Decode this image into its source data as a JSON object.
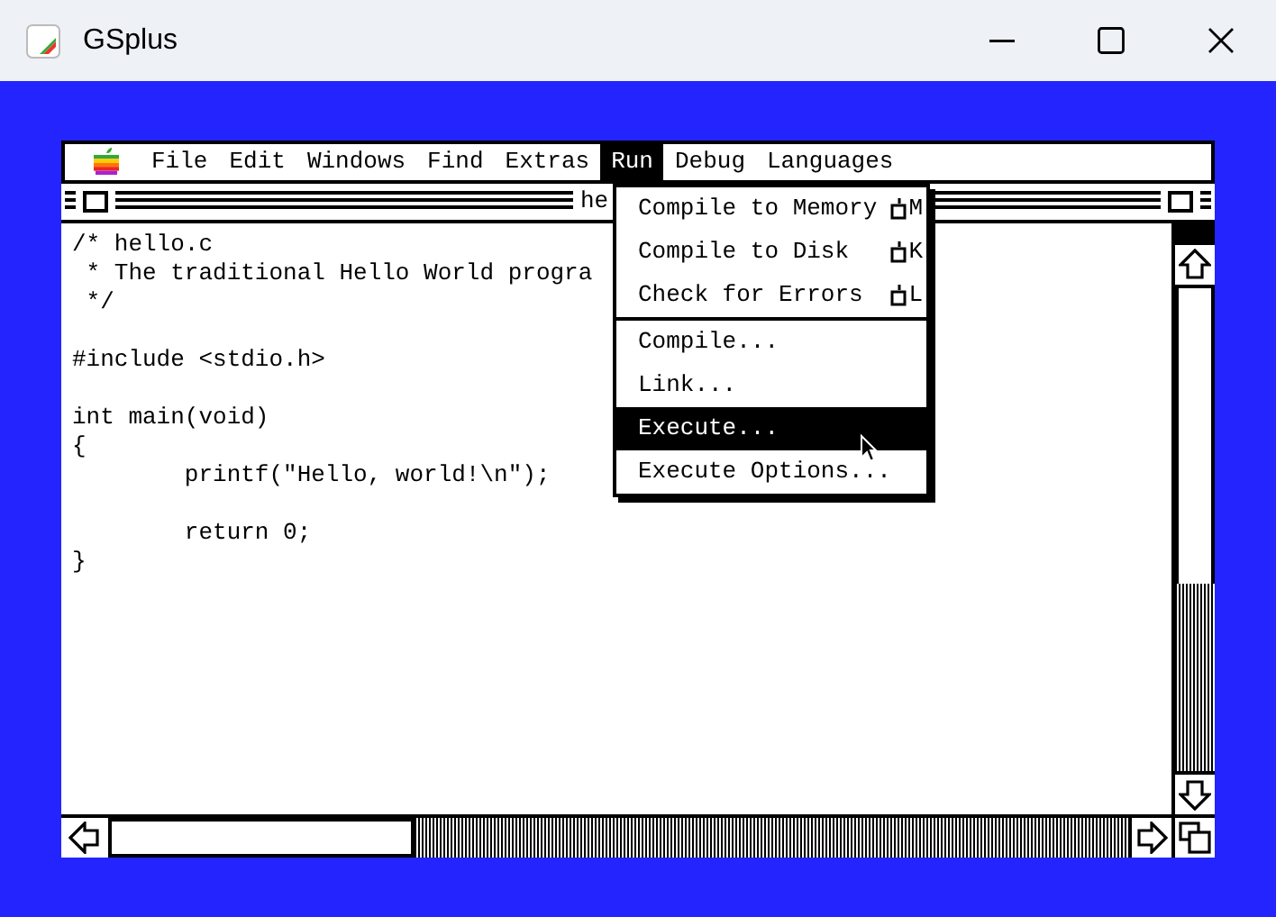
{
  "window": {
    "title": "GSplus"
  },
  "menubar": [
    {
      "label": "File",
      "selected": false
    },
    {
      "label": "Edit",
      "selected": false
    },
    {
      "label": "Windows",
      "selected": false
    },
    {
      "label": "Find",
      "selected": false
    },
    {
      "label": "Extras",
      "selected": false
    },
    {
      "label": "Run",
      "selected": true
    },
    {
      "label": "Debug",
      "selected": false
    },
    {
      "label": "Languages",
      "selected": false
    }
  ],
  "document": {
    "title": "he",
    "blocks": [
      [
        "/* hello.c",
        " * The traditional Hello World progra",
        " */"
      ],
      [
        "#include <stdio.h>"
      ],
      [
        "int main(void)",
        "{",
        "        printf(\"Hello, world!\\n\");"
      ],
      [
        "        return 0;",
        "}"
      ]
    ]
  },
  "menu": {
    "groups": [
      [
        {
          "label": "Compile to Memory",
          "shortcut": "M",
          "selected": false
        },
        {
          "label": "Compile to Disk",
          "shortcut": "K",
          "selected": false
        },
        {
          "label": "Check for Errors",
          "shortcut": "L",
          "selected": false
        }
      ],
      [
        {
          "label": "Compile...",
          "selected": false
        },
        {
          "label": "Link...",
          "selected": false
        },
        {
          "label": "Execute...",
          "selected": true
        },
        {
          "label": "Execute Options...",
          "selected": false
        }
      ]
    ]
  }
}
